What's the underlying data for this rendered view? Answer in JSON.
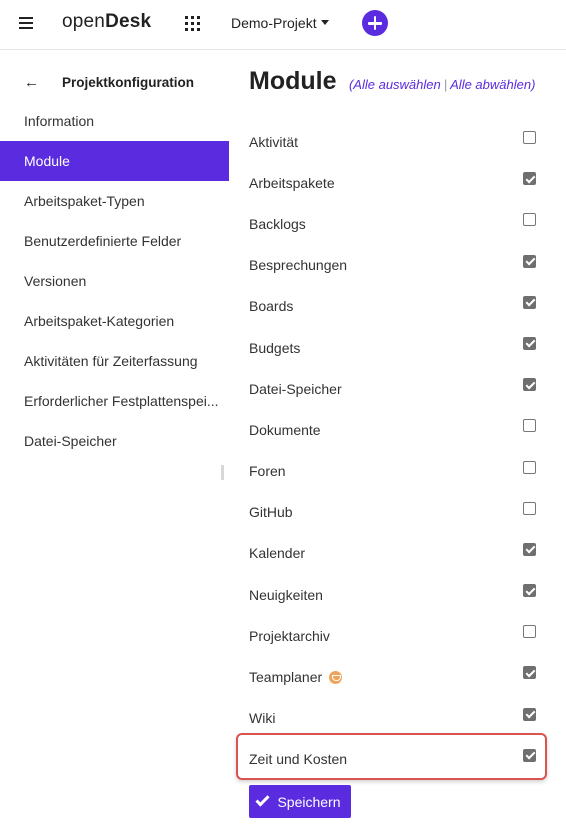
{
  "header": {
    "menu_icon": "hamburger-icon",
    "logo_light": "open",
    "logo_bold": "Desk",
    "apps_icon": "grid-icon",
    "project_name": "Demo-Projekt",
    "add_icon": "plus-icon",
    "accent_color": "#5b2be0"
  },
  "sidebar": {
    "back_icon": "arrow-left-icon",
    "title": "Projektkonfiguration",
    "items": [
      {
        "label": "Information",
        "active": false
      },
      {
        "label": "Module",
        "active": true
      },
      {
        "label": "Arbeitspaket-Typen",
        "active": false
      },
      {
        "label": "Benutzerdefinierte Felder",
        "active": false
      },
      {
        "label": "Versionen",
        "active": false
      },
      {
        "label": "Arbeitspaket-Kategorien",
        "active": false
      },
      {
        "label": "Aktivitäten für Zeiterfassung",
        "active": false
      },
      {
        "label": "Erforderlicher Festplattenspei...",
        "active": false
      },
      {
        "label": "Datei-Speicher",
        "active": false
      }
    ]
  },
  "main": {
    "title": "Module",
    "select_all": "Alle auswählen",
    "deselect_all": "Alle abwählen",
    "open_paren": "(",
    "separator": "|",
    "close_paren": ")",
    "modules": [
      {
        "label": "Aktivität",
        "checked": false
      },
      {
        "label": "Arbeitspakete",
        "checked": true
      },
      {
        "label": "Backlogs",
        "checked": false
      },
      {
        "label": "Besprechungen",
        "checked": true
      },
      {
        "label": "Boards",
        "checked": true
      },
      {
        "label": "Budgets",
        "checked": true
      },
      {
        "label": "Datei-Speicher",
        "checked": true
      },
      {
        "label": "Dokumente",
        "checked": false
      },
      {
        "label": "Foren",
        "checked": false
      },
      {
        "label": "GitHub",
        "checked": false
      },
      {
        "label": "Kalender",
        "checked": true
      },
      {
        "label": "Neuigkeiten",
        "checked": true
      },
      {
        "label": "Projektarchiv",
        "checked": false
      },
      {
        "label": "Teamplaner",
        "checked": true,
        "badge": "enterprise-icon"
      },
      {
        "label": "Wiki",
        "checked": true
      },
      {
        "label": "Zeit und Kosten",
        "checked": true,
        "highlighted": true
      }
    ],
    "save_label": "Speichern",
    "highlight_color": "#d9534f"
  }
}
